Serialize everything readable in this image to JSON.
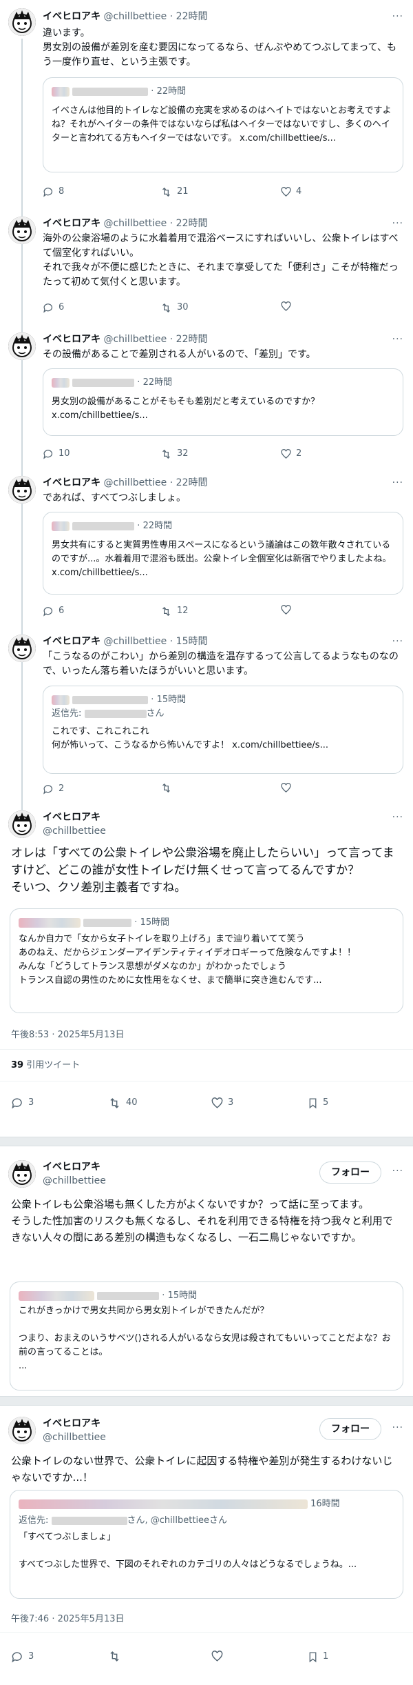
{
  "author": {
    "name": "イベヒロアキ",
    "handle": "@chillbettiee"
  },
  "sep": "·",
  "more": "···",
  "thread": [
    {
      "time": "22時間",
      "text": "違います。\n男女別の設備が差別を産む要因になってるなら、ぜんぶやめてつぶしてまって、もう一度作り直せ、という主張です。",
      "quote": {
        "time": "22時間",
        "text": "イベさんは他目的トイレなど設備の充実を求めるのはヘイトではないとお考えですよね？それがヘイターの条件ではないならば私はヘイターではないですし、多くのヘイターと言われてる方もヘイターではないです。 x.com/chillbettiee/s..."
      },
      "replies": "8",
      "retweets": "21",
      "likes": "4"
    },
    {
      "time": "22時間",
      "text": "海外の公衆浴場のように水着着用で混浴ベースにすればいいし、公衆トイレはすべて個室化すればいい。\nそれで我々が不便に感じたときに、それまで享受してた「便利さ」こそが特権だったって初めて気付くと思います。",
      "replies": "6",
      "retweets": "30",
      "likes": ""
    },
    {
      "time": "22時間",
      "text": "その設備があることで差別される人がいるので、「差別」です。",
      "quote": {
        "time": "22時間",
        "text": "男女別の設備があることがそもそも差別だと考えているのですか？ x.com/chillbettiee/s..."
      },
      "replies": "10",
      "retweets": "32",
      "likes": "2"
    },
    {
      "time": "22時間",
      "text": "であれば、すべてつぶしましょ。",
      "quote": {
        "time": "22時間",
        "text": "男女共有にすると実質男性専用スペースになるという議論はこの数年散々されているのですが...。水着着用で混浴も既出。公衆トイレ全個室化は新宿でやりましたよね。 x.com/chillbettiee/s..."
      },
      "replies": "6",
      "retweets": "12",
      "likes": ""
    },
    {
      "time": "15時間",
      "text": "「こうなるのがこわい」から差別の構造を温存するって公言してるようなものなので、いったん落ち着いたほうがいいと思います。",
      "quote": {
        "time": "15時間",
        "reply_prefix": "返信先: ",
        "reply_suffix": "さん",
        "text": "これです、これこれこれ\n何が怖いって、こうなるから怖いんですよ！ x.com/chillbettiee/s..."
      },
      "replies": "2",
      "retweets": "",
      "likes": ""
    }
  ],
  "main": {
    "text": "オレは「すべての公衆トイレや公衆浴場を廃止したらいい」って言ってますけど、どこの誰が女性トイレだけ無くせって言ってるんですか？\nそいつ、クソ差別主義者ですね。",
    "quote": {
      "time": "15時間",
      "text": "なんか自力で「女から女子トイレを取り上げろ」まで辿り着いてて笑う\nあのねえ、だからジェンダーアイデンティティイデオロギーって危険なんですよ！！\nみんな「どうしてトランス思想がダメなのか」がわかったでしょう\nトランス自認の男性のために女性用をなくせ、まで簡単に突き進むんです..."
    },
    "timestamp": "午後8:53 · 2025年5月13日",
    "quote_count": "39",
    "quote_label": "引用ツイート",
    "replies": "3",
    "retweets": "40",
    "likes": "3",
    "bookmarks": "5"
  },
  "second": {
    "follow_label": "フォロー",
    "text": "公衆トイレも公衆浴場も無くした方がよくないですか？って話に至ってます。\nそうした性加害のリスクも無くなるし、それを利用できる特権を持つ我々と利用できない人々の間にある差別の構造もなくなるし、一石二鳥じゃないですか。",
    "quote": {
      "time": "15時間",
      "text": "これがきっかけで男女共同から男女別トイレができたんだが？\n\nつまり、おまえのいうサベツ()される人がいるなら女児は殺されてもいいってことだよな？お前の言ってることは。\n..."
    }
  },
  "third": {
    "follow_label": "フォロー",
    "text": "公衆トイレのない世界で、公衆トイレに起因する特権や差別が発生するわけないじゃないですか...！",
    "quote": {
      "time": "16時間",
      "reply_prefix": "返信先: ",
      "reply_suffix": "さん, @chillbettieeさん",
      "text": "「すべてつぶしましょ」\n\nすべてつぶした世界で、下図のそれぞれのカテゴリの人々はどうなるでしょうね。..."
    },
    "timestamp": "午後7:46 · 2025年5月13日",
    "replies": "3",
    "retweets": "",
    "likes": "",
    "bookmarks": "1"
  }
}
